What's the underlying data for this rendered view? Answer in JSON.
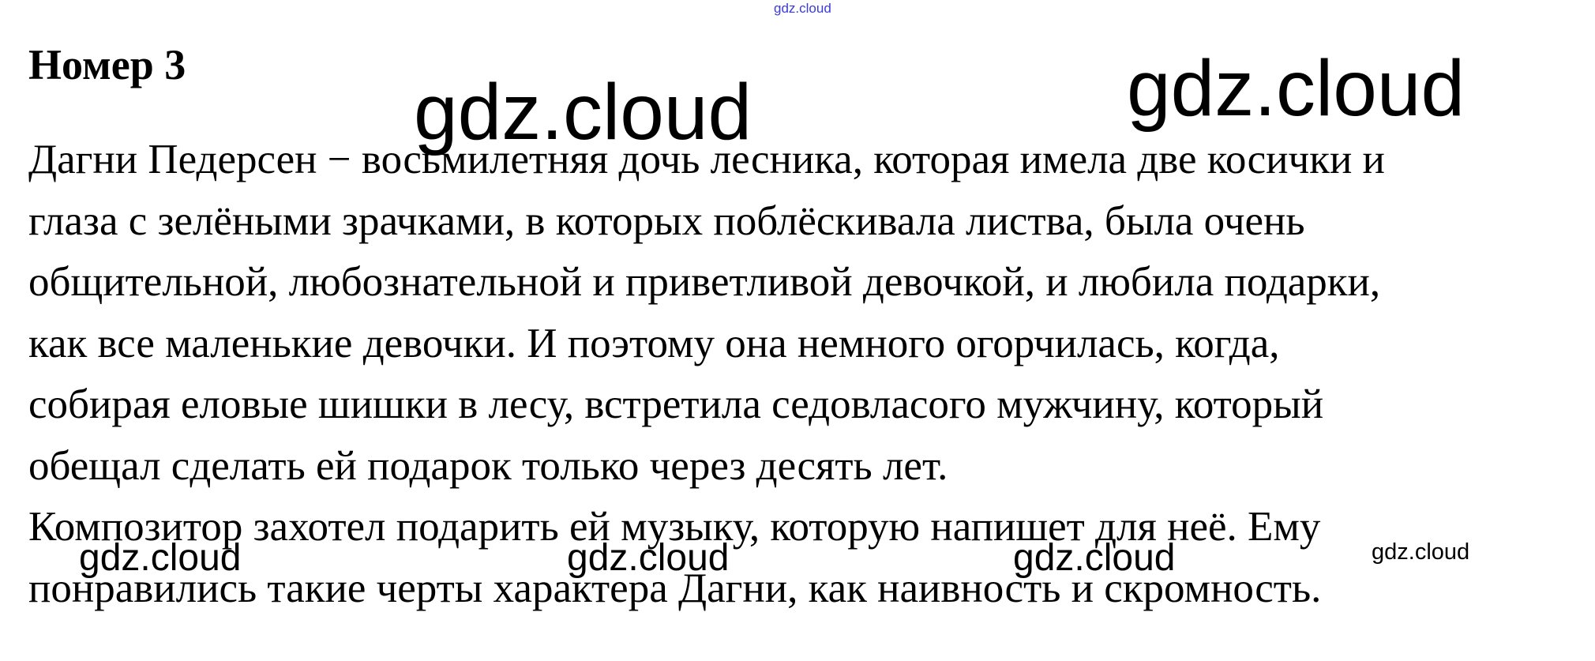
{
  "heading": "Номер 3",
  "paragraph_lines": [
    "Дагни Педерсен − восьмилетняя дочь лесника, которая имела две косички и",
    "глаза с зелёными зрачками, в которых поблёскивала листва, была очень",
    "общительной, любознательной и приветливой девочкой, и любила подарки,",
    "как все маленькие девочки. И поэтому она немного огорчилась, когда,",
    "собирая еловые шишки в лесу, встретила седовласого мужчину, который",
    "обещал сделать ей подарок только через десять лет.",
    "Композитор захотел подарить ей музыку, которую напишет для неё. Ему",
    "понравились такие черты характера Дагни, как наивность и скромность."
  ],
  "watermarks": {
    "top_small": "gdz.cloud",
    "big_1": "gdz.cloud",
    "big_2": "gdz.cloud",
    "mid_1": "gdz.cloud",
    "mid_2": "gdz.cloud",
    "mid_3": "gdz.cloud",
    "small_right": "gdz.cloud"
  },
  "colors": {
    "text": "#000000",
    "background": "#ffffff",
    "top_watermark": "#3b3bd6"
  }
}
